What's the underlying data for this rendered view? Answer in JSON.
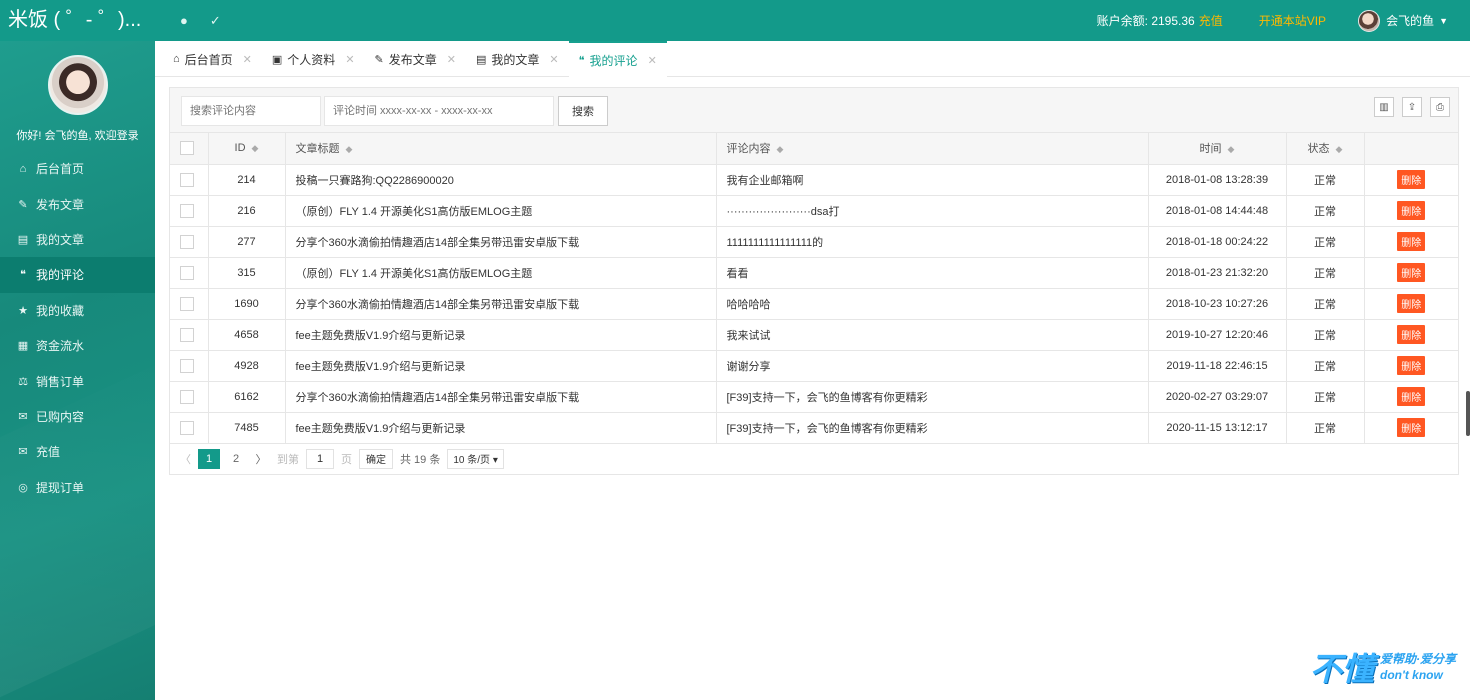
{
  "app": {
    "logo": "米饭 ( ゜- ゜)...",
    "balance_label": "账户余额: 2195.36",
    "recharge": "充值",
    "vip": "开通本站VIP",
    "username": "会飞的鱼",
    "top_icons": [
      "●",
      "✓"
    ]
  },
  "sidebar": {
    "welcome": "你好! 会飞的鱼, 欢迎登录",
    "items": [
      {
        "label": "后台首页",
        "icon": "⌂"
      },
      {
        "label": "发布文章",
        "icon": "✎"
      },
      {
        "label": "我的文章",
        "icon": "▤"
      },
      {
        "label": "我的评论",
        "icon": "❝"
      },
      {
        "label": "我的收藏",
        "icon": "★"
      },
      {
        "label": "资金流水",
        "icon": "▦"
      },
      {
        "label": "销售订单",
        "icon": "⚖"
      },
      {
        "label": "已购内容",
        "icon": "✉"
      },
      {
        "label": "充值",
        "icon": "✉"
      },
      {
        "label": "提现订单",
        "icon": "◎"
      }
    ]
  },
  "tabs": [
    {
      "label": "后台首页",
      "icon": "⌂"
    },
    {
      "label": "个人资料",
      "icon": "▣"
    },
    {
      "label": "发布文章",
      "icon": "✎"
    },
    {
      "label": "我的文章",
      "icon": "▤"
    },
    {
      "label": "我的评论",
      "icon": "❝"
    }
  ],
  "toolbar": {
    "search_placeholder": "搜索评论内容",
    "time_placeholder": "评论时间 xxxx-xx-xx - xxxx-xx-xx",
    "search_button": "搜索",
    "tool_icons": [
      "▥",
      "⇪",
      "⎙"
    ]
  },
  "table": {
    "headers": {
      "id": "ID",
      "title": "文章标题",
      "content": "评论内容",
      "time": "时间",
      "status": "状态"
    },
    "delete_label": "删除",
    "rows": [
      {
        "id": "214",
        "title": "投稿一只賽路狗:QQ2286900020",
        "content": "我有企业邮箱啊",
        "time": "2018-01-08 13:28:39",
        "status": "正常"
      },
      {
        "id": "216",
        "title": "（原创）FLY 1.4 开源美化S1高仿版EMLOG主题",
        "content": "·······················dsa打",
        "time": "2018-01-08 14:44:48",
        "status": "正常"
      },
      {
        "id": "277",
        "title": "分享个360水滴偷拍情趣酒店14部全集另带迅雷安卓版下载",
        "content": "1111111111111111的",
        "time": "2018-01-18 00:24:22",
        "status": "正常"
      },
      {
        "id": "315",
        "title": "（原创）FLY 1.4 开源美化S1高仿版EMLOG主题",
        "content": "看看",
        "time": "2018-01-23 21:32:20",
        "status": "正常"
      },
      {
        "id": "1690",
        "title": "分享个360水滴偷拍情趣酒店14部全集另带迅雷安卓版下载",
        "content": "哈哈哈哈",
        "time": "2018-10-23 10:27:26",
        "status": "正常"
      },
      {
        "id": "4658",
        "title": "fee主题免费版V1.9介绍与更新记录",
        "content": "我来试试",
        "time": "2019-10-27 12:20:46",
        "status": "正常"
      },
      {
        "id": "4928",
        "title": "fee主题免费版V1.9介绍与更新记录",
        "content": "谢谢分享",
        "time": "2019-11-18 22:46:15",
        "status": "正常"
      },
      {
        "id": "6162",
        "title": "分享个360水滴偷拍情趣酒店14部全集另带迅雷安卓版下载",
        "content": "[F39]支持一下，会飞的鱼博客有你更精彩",
        "time": "2020-02-27 03:29:07",
        "status": "正常"
      },
      {
        "id": "7485",
        "title": "fee主题免费版V1.9介绍与更新记录",
        "content": "[F39]支持一下，会飞的鱼博客有你更精彩",
        "time": "2020-11-15 13:12:17",
        "status": "正常"
      }
    ]
  },
  "pager": {
    "prev": "〈",
    "current": "1",
    "page2": "2",
    "next": "〉",
    "goto": "到第",
    "goto_value": "1",
    "page_unit": "页",
    "confirm": "确定",
    "total": "共 19 条",
    "per_page": "10 条/页 ▾"
  },
  "watermark": {
    "big": "不懂",
    "line1": "爱帮助·爱分享",
    "line2": "don't know"
  }
}
